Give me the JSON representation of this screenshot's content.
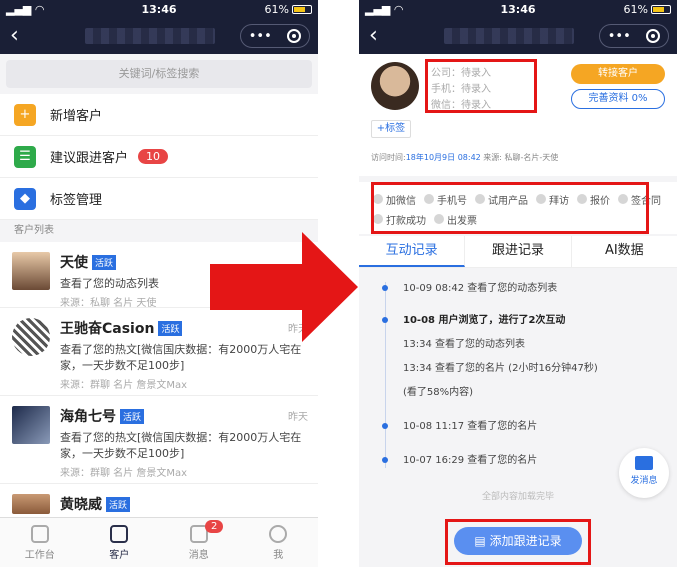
{
  "status": {
    "time": "13:46",
    "battery": "61%",
    "battery_level": 0.61
  },
  "left": {
    "search_placeholder": "关键词/标签搜索",
    "menu": [
      {
        "label": "新增客户",
        "icon": "add-user-icon",
        "color": "#f5a623"
      },
      {
        "label": "建议跟进客户",
        "icon": "follow-up-icon",
        "color": "#2eaa4a",
        "badge": "10"
      },
      {
        "label": "标签管理",
        "icon": "tag-icon",
        "color": "#2a6fe0"
      }
    ],
    "section_label": "客户列表",
    "customers": [
      {
        "name": "天使",
        "tag": "活跃",
        "desc": "查看了您的动态列表",
        "source": "来源：私聊 名片 天使",
        "time": ""
      },
      {
        "name": "王驰奋Casion",
        "tag": "活跃",
        "desc": "查看了您的热文[微信国庆数据：有2000万人宅在家，一天步数不足100步]",
        "source": "来源：群聊 名片 詹景文Max",
        "time": "昨天"
      },
      {
        "name": "海角七号",
        "tag": "活跃",
        "desc": "查看了您的热文[微信国庆数据：有2000万人宅在家，一天步数不足100步]",
        "source": "来源：群聊 名片 詹景文Max",
        "time": "昨天"
      },
      {
        "name": "黄晓威",
        "tag": "活跃",
        "desc": "",
        "source": "",
        "time": ""
      }
    ],
    "tabbar": [
      {
        "label": "工作台",
        "icon": "workbench-icon"
      },
      {
        "label": "客户",
        "icon": "customer-icon",
        "active": true
      },
      {
        "label": "消息",
        "icon": "message-icon",
        "badge": "2"
      },
      {
        "label": "我",
        "icon": "profile-icon"
      }
    ]
  },
  "right": {
    "fields": [
      "公司：待录入",
      "手机：待录入",
      "微信：待录入"
    ],
    "convert_button": "转接客户",
    "complete_button": "完善资料 0%",
    "add_tag": "+标签",
    "visit_prefix": "访问时间:",
    "visit_time": "18年10月9日 08:42",
    "visit_source": "来源: 私聊-名片-天使",
    "chips": [
      "加微信",
      "手机号",
      "试用产品",
      "拜访",
      "报价",
      "签合同",
      "打款成功",
      "出发票"
    ],
    "tabs": [
      "互动记录",
      "跟进记录",
      "AI数据"
    ],
    "timeline": [
      {
        "text": "10-09 08:42 查看了您的动态列表",
        "dot": true,
        "bold": false
      },
      {
        "text": "10-08 用户浏览了，进行了2次互动",
        "dot": true,
        "bold": true
      },
      {
        "text": "13:34 查看了您的动态列表",
        "dot": false,
        "bold": false
      },
      {
        "text": "13:34 查看了您的名片 (2小时16分钟47秒)",
        "dot": false,
        "bold": false
      },
      {
        "text": "(看了58%内容)",
        "dot": false,
        "bold": false
      },
      {
        "text": "10-08 11:17 查看了您的名片",
        "dot": true,
        "bold": false
      },
      {
        "text": "10-07 16:29 查看了您的名片",
        "dot": true,
        "bold": false
      }
    ],
    "float_label": "发消息",
    "loaded_text": "全部内容加载完毕",
    "add_record": "添加跟进记录"
  }
}
